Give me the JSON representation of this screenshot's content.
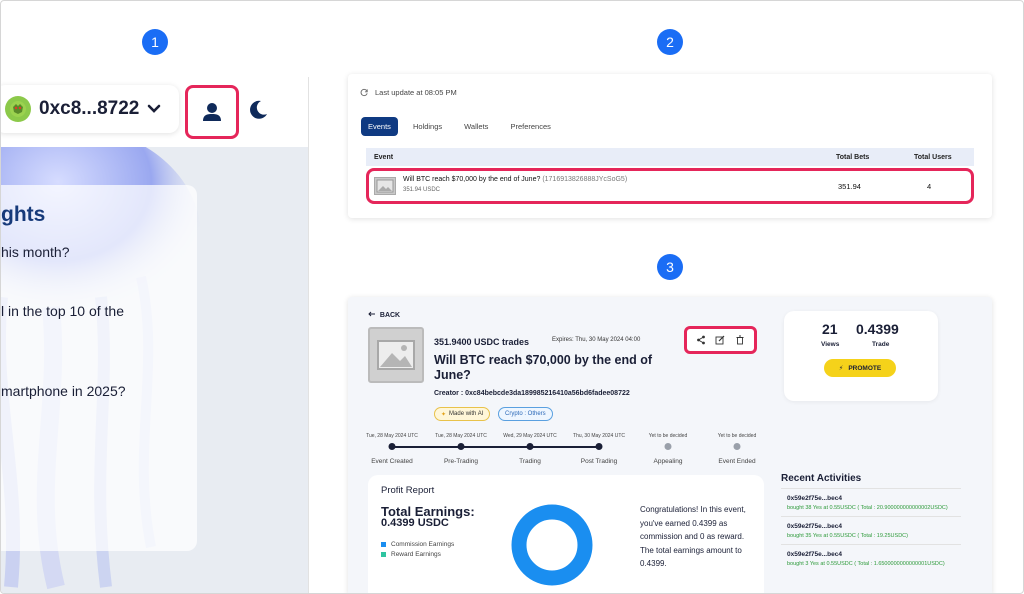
{
  "steps": [
    "1",
    "2",
    "3"
  ],
  "panel1": {
    "wallet_address": "0xc8...8722",
    "insights_title": "ghts",
    "questions": [
      "his month?",
      "l in the top 10 of the",
      "martphone in 2025?"
    ]
  },
  "panel2": {
    "last_update": "Last update at 08:05 PM",
    "tabs": [
      "Events",
      "Holdings",
      "Wallets",
      "Preferences"
    ],
    "table": {
      "headers": {
        "event": "Event",
        "total_bets": "Total Bets",
        "total_users": "Total Users"
      },
      "rows": [
        {
          "title": "Will BTC reach $70,000 by the end of June?",
          "id": "(1716913826888JYcSoG5)",
          "amount": "351.94 USDC",
          "total_bets": "351.94",
          "total_users": "4"
        }
      ]
    }
  },
  "panel3": {
    "back_label": "BACK",
    "trades": "351.9400 USDC trades",
    "expires": "Expires: Thu, 30 May 2024 04:00",
    "title": "Will BTC reach $70,000 by the end of June?",
    "creator": "Creator : 0xc84bebcde3da189985216410a56bd6fadee08722",
    "chips": {
      "ai": "Made with AI",
      "category": "Crypto : Others"
    },
    "actions": [
      "share-icon",
      "edit-icon",
      "trash-icon"
    ],
    "timeline": [
      {
        "date": "Tue, 28 May 2024 UTC",
        "label": "Event Created",
        "done": true
      },
      {
        "date": "Tue, 28 May 2024 UTC",
        "label": "Pre-Trading",
        "done": true
      },
      {
        "date": "Wed, 29 May 2024 UTC",
        "label": "Trading",
        "done": true
      },
      {
        "date": "Thu, 30 May 2024 UTC",
        "label": "Post Trading",
        "done": true
      },
      {
        "date": "Yet to be decided",
        "label": "Appealing",
        "done": false
      },
      {
        "date": "Yet to be decided",
        "label": "Event Ended",
        "done": false
      }
    ],
    "stats": {
      "views_value": "21",
      "views_label": "Views",
      "trade_value": "0.4399",
      "trade_label": "Trade",
      "promote_label": "PROMOTE"
    },
    "profit": {
      "title": "Profit Report",
      "earnings_heading": "Total Earnings:",
      "earnings_value": "0.4399 USDC",
      "legend": [
        {
          "label": "Commission Earnings",
          "color": "#1a8ef0"
        },
        {
          "label": "Reward Earnings",
          "color": "#2ec4a0"
        }
      ],
      "commission_share": 1.0,
      "message": "Congratulations! In this event, you've earned 0.4399 as commission and 0 as reward. The total earnings amount to 0.4399."
    },
    "recent": {
      "title": "Recent Activities",
      "items": [
        {
          "address": "0x59e2f75e...bec4",
          "desc": "bought 38 Yes at 0.55USDC ( Total : 20.900000000000002USDC)"
        },
        {
          "address": "0x59e2f75e...bec4",
          "desc": "bought 35 Yes at 0.55USDC ( Total : 19.25USDC)"
        },
        {
          "address": "0x59e2f75e...bec4",
          "desc": "bought 3 Yes at 0.55USDC ( Total : 1.6500000000000001USDC)"
        }
      ]
    }
  },
  "colors": {
    "highlight": "#e5265a",
    "accent": "#1a6df5",
    "navy": "#0f3a82",
    "promote": "#f5d21a"
  }
}
